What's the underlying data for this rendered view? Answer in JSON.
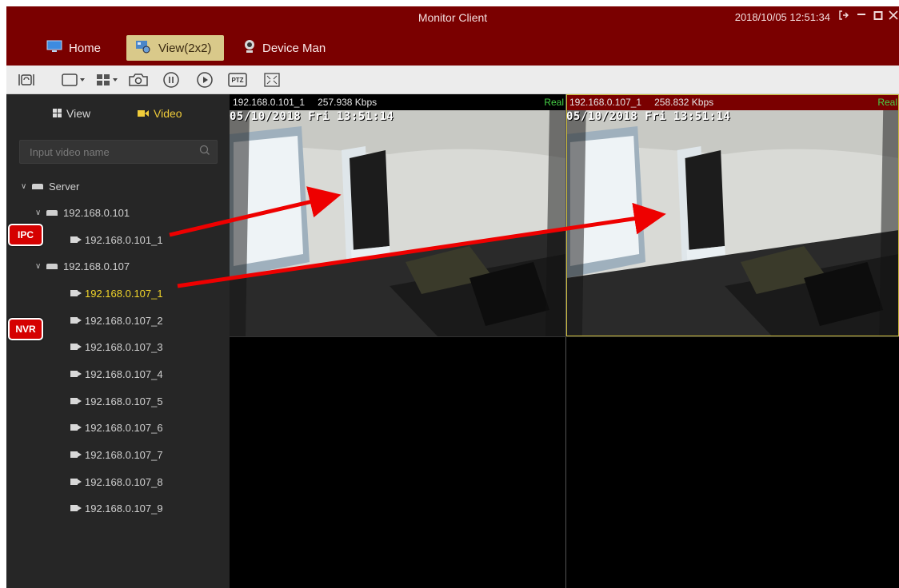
{
  "window": {
    "title": "Monitor Client",
    "clock": "2018/10/05 12:51:34",
    "controls": [
      "logout-icon",
      "minimize-icon",
      "maximize-icon",
      "close-icon"
    ]
  },
  "nav": {
    "home": "Home",
    "view": "View(2x2)",
    "device": "Device Man"
  },
  "toolbar": {
    "ptz_label": "PTZ",
    "buttons": [
      "refresh-icon",
      "layout-single-icon",
      "layout-grid-icon",
      "snapshot-icon",
      "pause-icon",
      "play-icon",
      "ptz-icon",
      "fullscreen-icon"
    ]
  },
  "sidebar": {
    "tab_view": "View",
    "tab_video": "Video",
    "search_placeholder": "Input video name",
    "server": "Server",
    "device1": "192.168.0.101",
    "device1_channel": "192.168.0.101_1",
    "device2": "192.168.0.107",
    "device2_channels": [
      "192.168.0.107_1",
      "192.168.0.107_2",
      "192.168.0.107_3",
      "192.168.0.107_4",
      "192.168.0.107_5",
      "192.168.0.107_6",
      "192.168.0.107_7",
      "192.168.0.107_8",
      "192.168.0.107_9"
    ],
    "selected_channel": "192.168.0.107_1"
  },
  "callouts": {
    "ipc": "IPC",
    "nvr": "NVR"
  },
  "panes": [
    {
      "name": "192.168.0.101_1",
      "bitrate": "257.938 Kbps",
      "status": "Real",
      "osd": "05/10/2018  Fri 13:51:14"
    },
    {
      "name": "192.168.0.107_1",
      "bitrate": "258.832 Kbps",
      "status": "Real",
      "osd": "05/10/2018  Fri 13:51:14"
    }
  ],
  "colors": {
    "header": "#7a0000",
    "active_nav": "#d9c98a",
    "selected_text": "#f0d42a",
    "status_real": "#46d346",
    "callout": "#d50000",
    "arrow": "#ee0000"
  }
}
